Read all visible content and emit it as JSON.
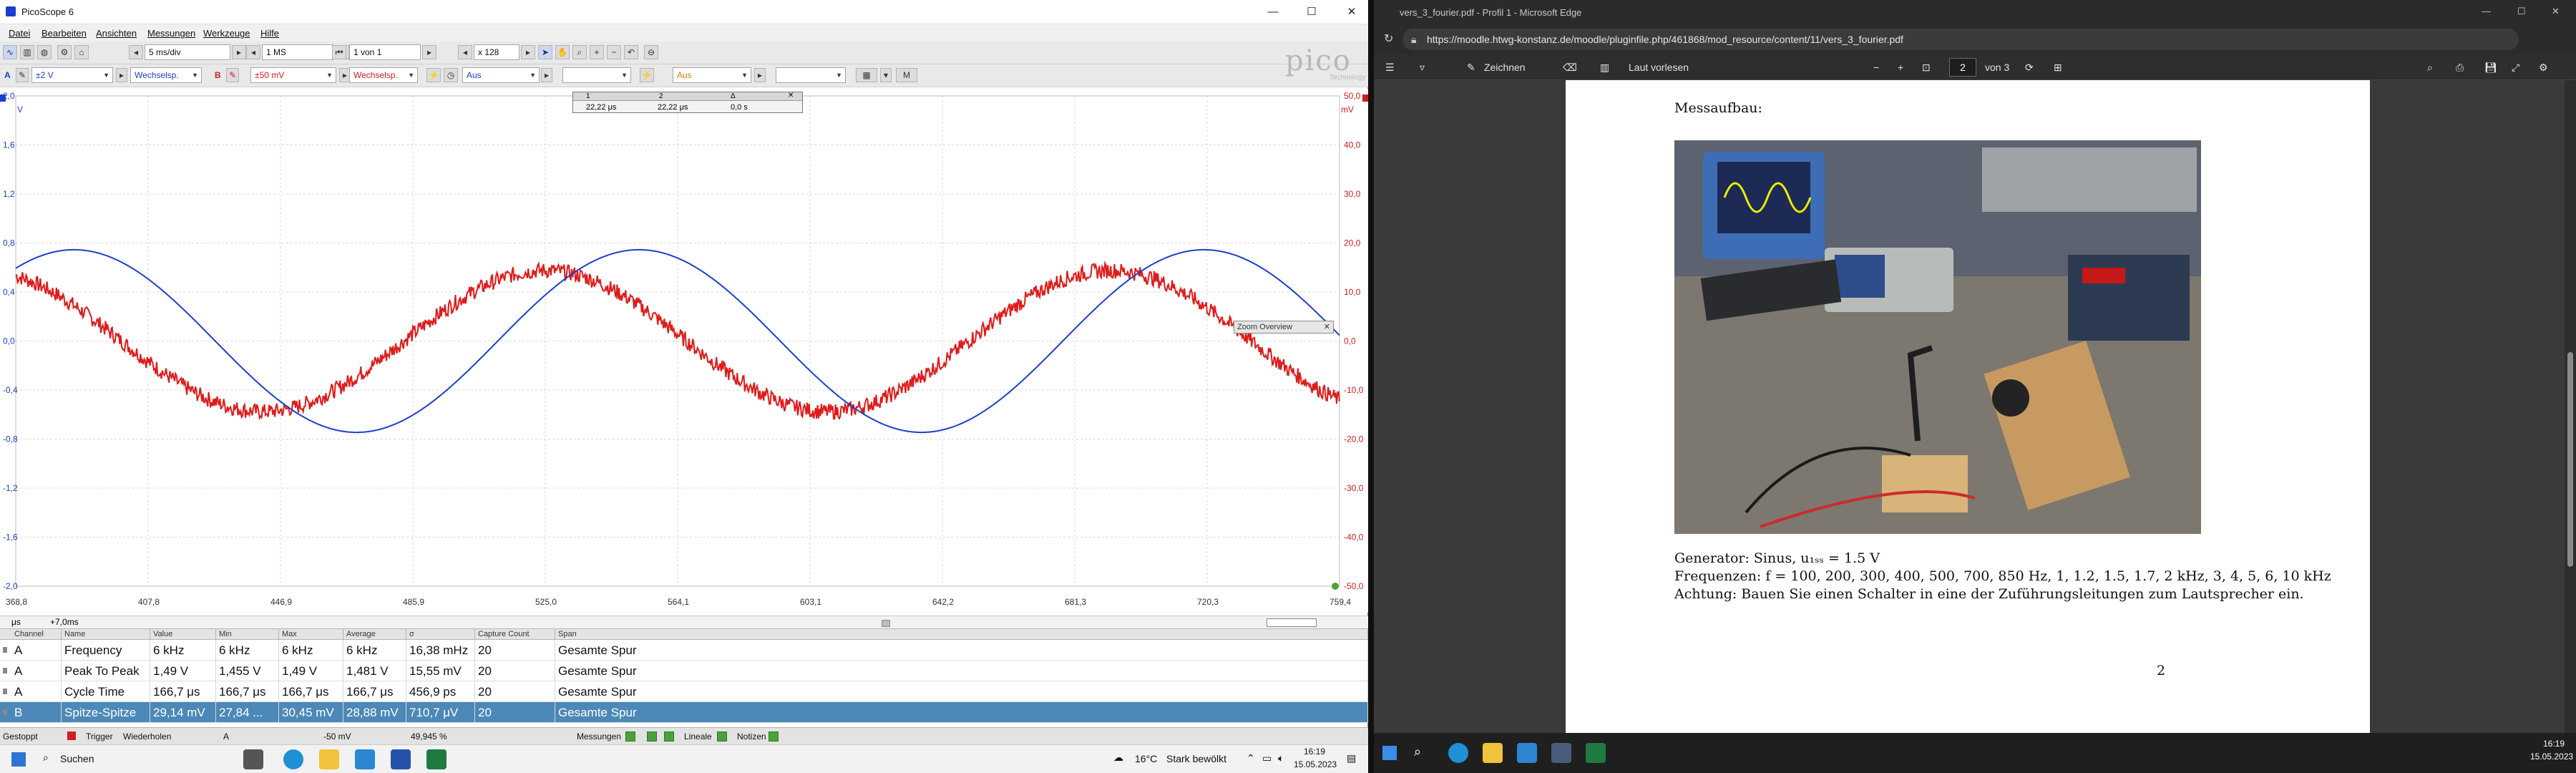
{
  "picoscope": {
    "title": "PicoScope 6",
    "window_controls": [
      "—",
      "☐",
      "✕"
    ],
    "menu": [
      "Datei",
      "Bearbeiten",
      "Ansichten",
      "Messungen",
      "Werkzeuge",
      "Hilfe"
    ],
    "timebase": "5 ms/div",
    "samples": "1 MS",
    "capture": "1 von 1",
    "zoom_factor": "x 128",
    "chA": {
      "label": "A",
      "range": "±2 V",
      "coupling": "Wechselsp."
    },
    "chB": {
      "label": "B",
      "range": "±50 mV",
      "coupling": "Wechselsp."
    },
    "trigger_mode": "Aus",
    "trigger_source": "Aus",
    "logo": "pico",
    "logo_sub": "Technology",
    "y_left": [
      "2,0",
      "1,6",
      "1,2",
      "0,8",
      "0,4",
      "0,0",
      "-0,4",
      "-0,8",
      "-1,2",
      "-1,6",
      "-2,0"
    ],
    "y_left_unit": "V",
    "y_right": [
      "50,0",
      "40,0",
      "30,0",
      "20,0",
      "10,0",
      "0,0",
      "-10,0",
      "-20,0",
      "-30,0",
      "-40,0",
      "-50,0"
    ],
    "y_right_unit": "mV",
    "x_ticks": [
      "368,8",
      "407,8",
      "446,9",
      "485,9",
      "525,0",
      "564,1",
      "603,1",
      "642,2",
      "681,3",
      "720,3",
      "759,4"
    ],
    "x_unit": "μs",
    "x_offset": "+7,0ms",
    "ruler_head": [
      "1",
      "2",
      "Δ"
    ],
    "ruler_values": [
      "22,22 μs",
      "22,22 μs",
      "0,0 s"
    ],
    "zoom_overview": "Zoom Overview",
    "measure_headers": [
      "Channel",
      "Name",
      "Value",
      "Min",
      "Max",
      "Average",
      "σ",
      "Capture Count",
      "Span"
    ],
    "measurements": [
      [
        "A",
        "Frequency",
        "6 kHz",
        "6 kHz",
        "6 kHz",
        "6 kHz",
        "16,38 mHz",
        "20",
        "Gesamte Spur"
      ],
      [
        "A",
        "Peak To Peak",
        "1,49 V",
        "1,455 V",
        "1,49 V",
        "1,481 V",
        "15,55 mV",
        "20",
        "Gesamte Spur"
      ],
      [
        "A",
        "Cycle Time",
        "166,7 μs",
        "166,7 μs",
        "166,7 μs",
        "166,7 μs",
        "456,9 ps",
        "20",
        "Gesamte Spur"
      ],
      [
        "B",
        "Spitze-Spitze",
        "29,14 mV",
        "27,84 ...",
        "30,45 mV",
        "28,88 mV",
        "710,7 μV",
        "20",
        "Gesamte Spur"
      ]
    ],
    "status": {
      "stopped": "Gestoppt",
      "trigger": "Trigger",
      "trigger_mode": "Wiederholen",
      "trig_level": "-50 mV",
      "trig_pos": "49,945 %",
      "measure": "Messungen",
      "lineal": "Lineale",
      "notes": "Notizen"
    },
    "wave_colors": {
      "chA": "#1c3fcf",
      "chB": "#e01b1b"
    }
  },
  "edge": {
    "title": "vers_3_fourier.pdf - Profil 1 - Microsoft Edge",
    "url": "https://moodle.htwg-konstanz.de/moodle/pluginfile.php/461868/mod_resource/content/11/vers_3_fourier.pdf",
    "toolbar": {
      "draw": "Zeichnen",
      "read_aloud": "Laut vorlesen",
      "page": "2",
      "page_of": "von 3"
    },
    "pdf": {
      "heading": "Messaufbau:",
      "line1": "Generator: Sinus, u₁ₛₛ = 1.5 V",
      "line2": "Frequenzen: f = 100, 200, 300, 400, 500, 700, 850 Hz, 1, 1.2, 1.5, 1.7, 2 kHz, 3, 4, 5, 6, 10 kHz",
      "line3": "Achtung: Bauen Sie einen Schalter in eine der Zuführungsleitungen zum Lautsprecher ein.",
      "page_number": "2"
    }
  },
  "taskbar_left": {
    "search": "Suchen",
    "weather": "16°C",
    "weather_desc": "Stark bewölkt",
    "time": "16:19",
    "date": "15.05.2023"
  },
  "taskbar_right": {
    "time": "16:19",
    "date": "15.05.2023"
  }
}
